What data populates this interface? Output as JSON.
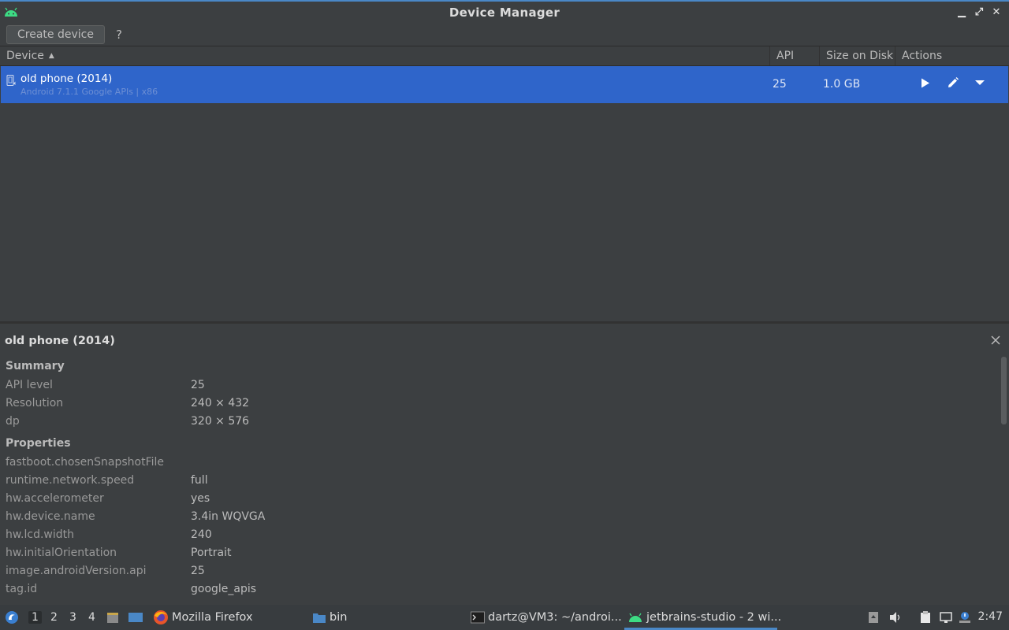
{
  "window": {
    "title": "Device Manager",
    "controls": {
      "minimize": "▁",
      "restore": "⤢",
      "close": "✕"
    }
  },
  "toolbar": {
    "create_label": "Create device",
    "help_label": "?"
  },
  "table": {
    "columns": [
      "Device",
      "API",
      "Size on Disk",
      "Actions"
    ],
    "sort_indicator": "▲",
    "rows": [
      {
        "name": "old phone (2014)",
        "subtitle": "Android 7.1.1 Google APIs | x86",
        "api": "25",
        "size": "1.0 GB",
        "actions": [
          "play-icon",
          "edit-icon",
          "dropdown-icon"
        ]
      }
    ]
  },
  "details": {
    "title": "old phone (2014)",
    "summary_label": "Summary",
    "summary": [
      {
        "key": "API level",
        "value": "25"
      },
      {
        "key": "Resolution",
        "value": "240 × 432"
      },
      {
        "key": "dp",
        "value": "320 × 576"
      }
    ],
    "properties_label": "Properties",
    "properties": [
      {
        "key": "fastboot.chosenSnapshotFile",
        "value": ""
      },
      {
        "key": "runtime.network.speed",
        "value": "full"
      },
      {
        "key": "hw.accelerometer",
        "value": "yes"
      },
      {
        "key": "hw.device.name",
        "value": "3.4in WQVGA"
      },
      {
        "key": "hw.lcd.width",
        "value": "240"
      },
      {
        "key": "hw.initialOrientation",
        "value": "Portrait"
      },
      {
        "key": "image.androidVersion.api",
        "value": "25"
      },
      {
        "key": "tag.id",
        "value": "google_apis"
      }
    ]
  },
  "taskbar": {
    "workspaces": [
      "1",
      "2",
      "3",
      "4"
    ],
    "apps": [
      {
        "label": "Mozilla Firefox",
        "icon": "firefox-icon"
      },
      {
        "label": "bin",
        "icon": "folder-icon"
      },
      {
        "label": "dartz@VM3: ~/androi...",
        "icon": "terminal-icon"
      },
      {
        "label": "jetbrains-studio - 2 wi...",
        "icon": "android-icon"
      }
    ],
    "clock": "2:47"
  },
  "colors": {
    "selection": "#2f65ca",
    "android_green": "#3ddc84",
    "accent": "#4a88c7"
  }
}
